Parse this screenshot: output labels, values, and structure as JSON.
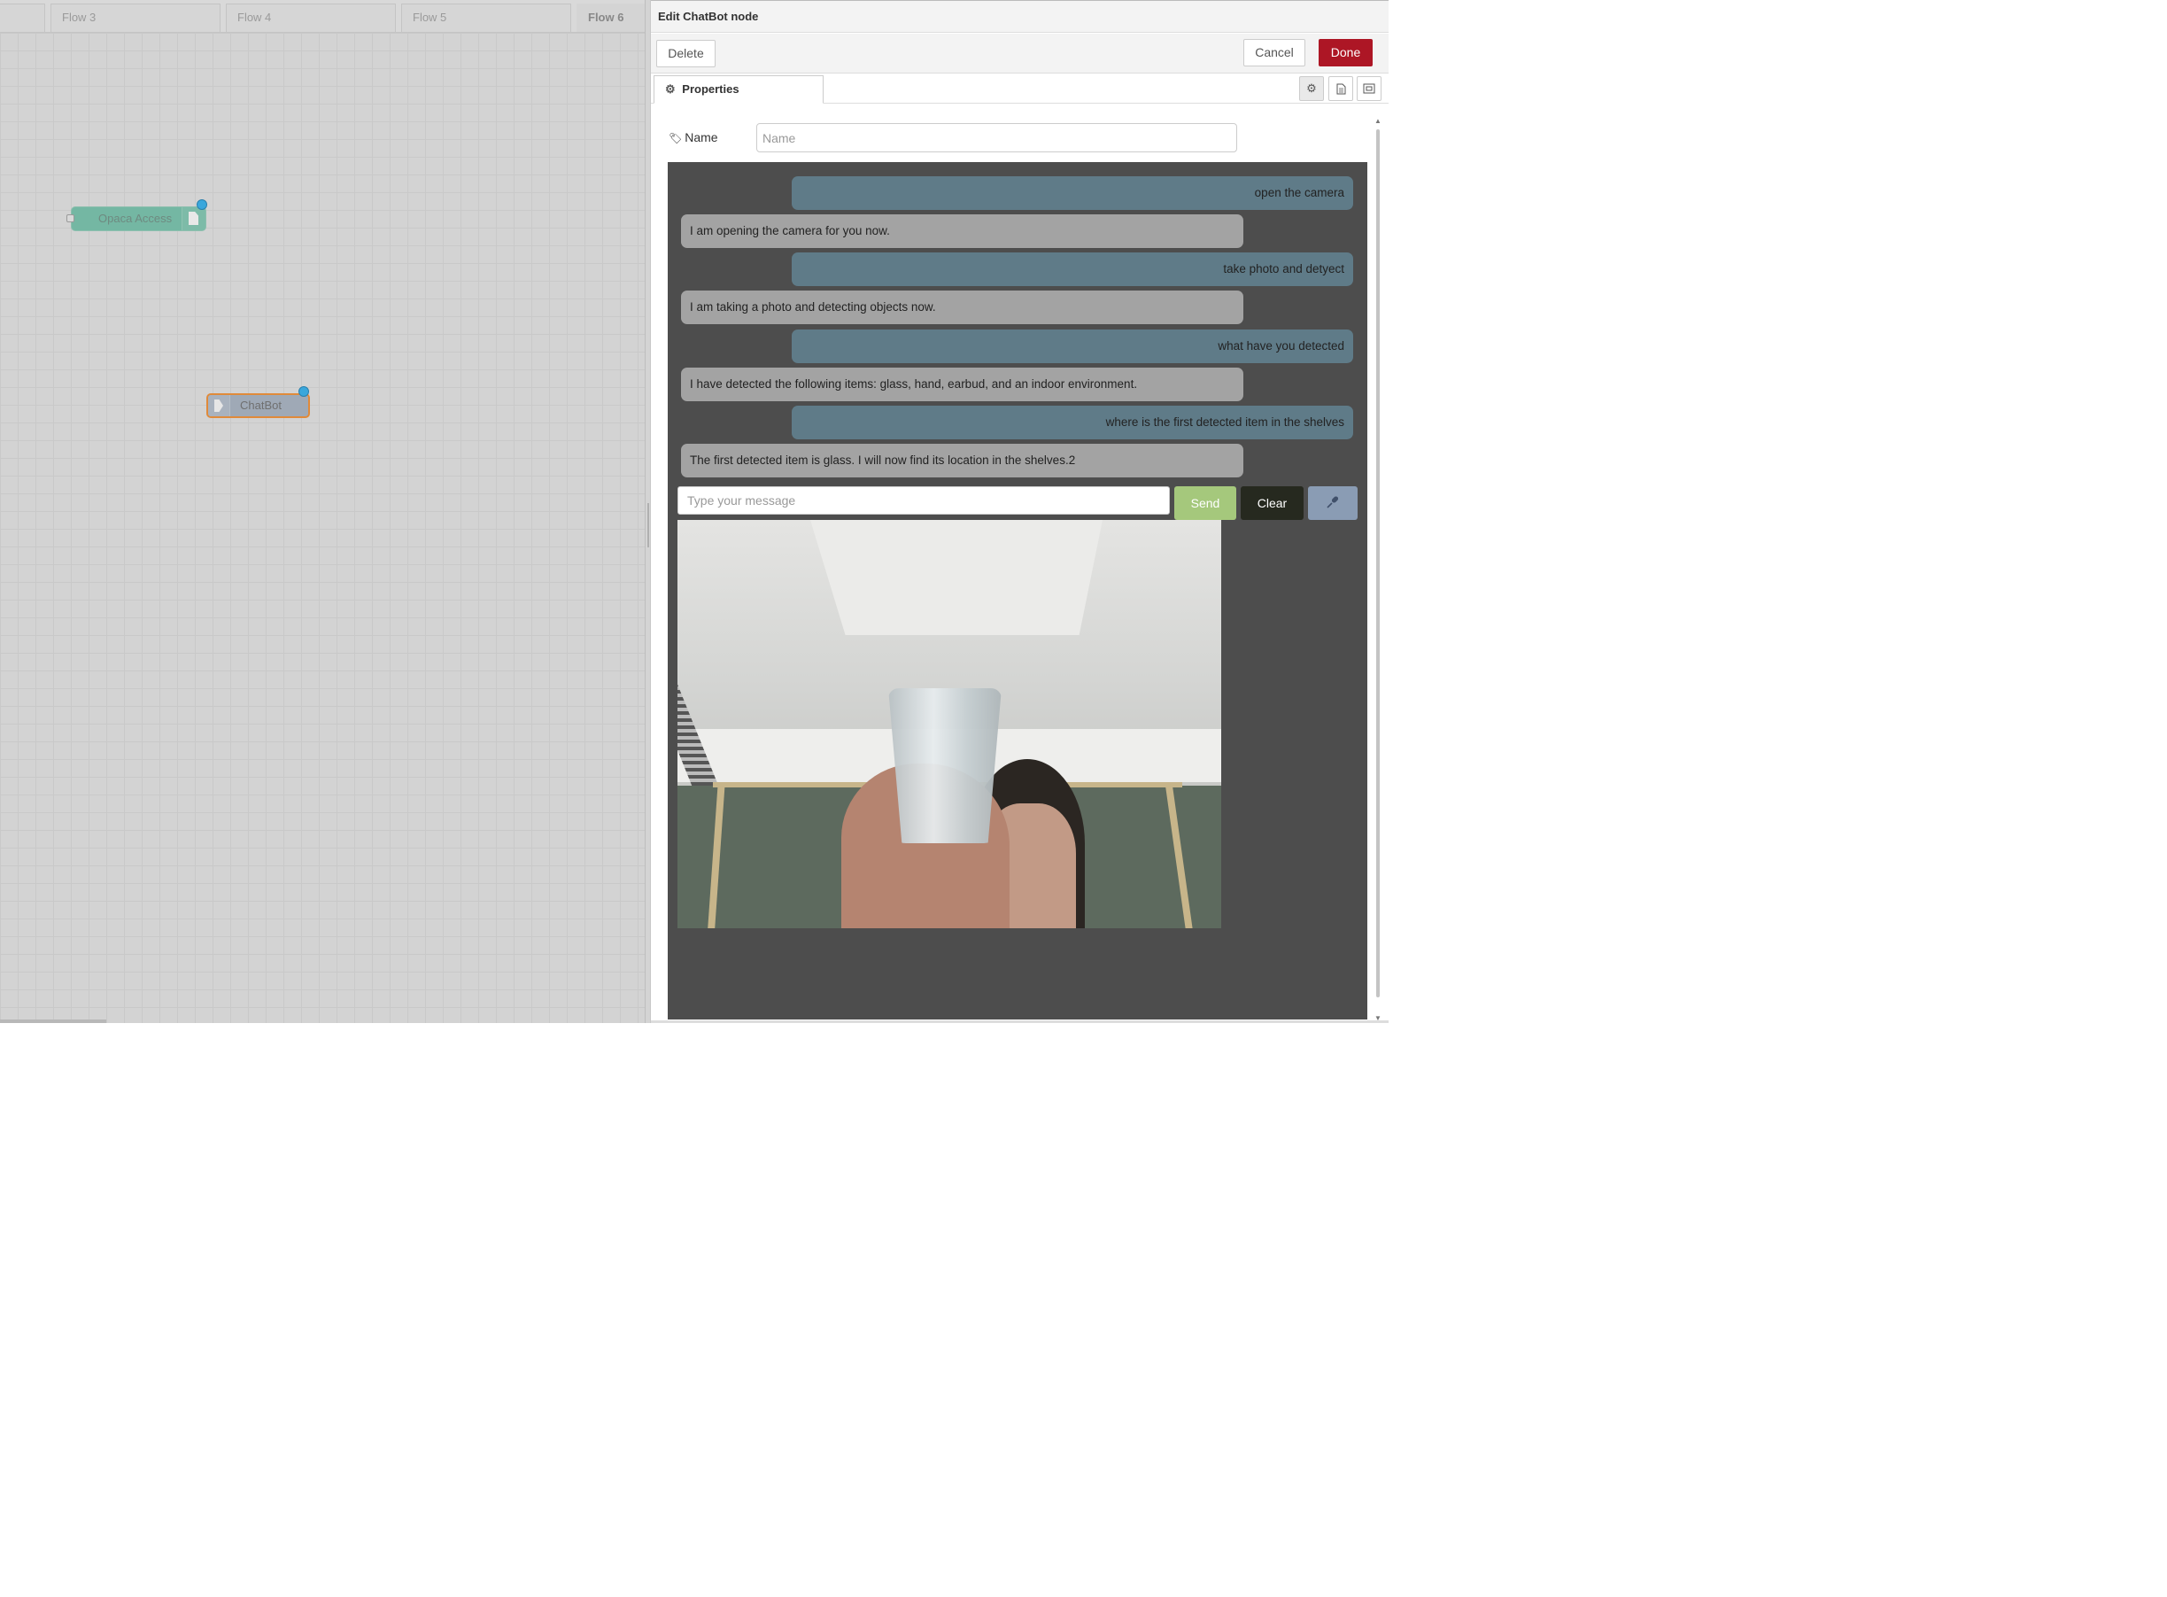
{
  "workspace": {
    "tabs": [
      {
        "label": ""
      },
      {
        "label": "Flow 3"
      },
      {
        "label": "Flow 4"
      },
      {
        "label": "Flow 5"
      },
      {
        "label": "Flow 6"
      }
    ],
    "nodes": {
      "opaca": {
        "label": "Opaca Access",
        "color": "#74b7a3"
      },
      "chatbot": {
        "label": "ChatBot",
        "color": "#9fa9b6"
      }
    }
  },
  "tray": {
    "title": "Edit ChatBot node",
    "toolbar": {
      "delete_label": "Delete",
      "cancel_label": "Cancel",
      "done_label": "Done"
    },
    "tabs": {
      "properties_label": "Properties",
      "icons": [
        "gear-icon",
        "document-icon",
        "appearance-icon"
      ]
    },
    "name_field": {
      "label": "Name",
      "placeholder": "Name",
      "value": ""
    },
    "chat": {
      "messages": [
        {
          "role": "user",
          "text": "open the camera"
        },
        {
          "role": "bot",
          "text": "I am opening the camera for you now."
        },
        {
          "role": "user",
          "text": "take photo and detyect"
        },
        {
          "role": "bot",
          "text": "I am taking a photo and detecting objects now."
        },
        {
          "role": "user",
          "text": "what have you detected"
        },
        {
          "role": "bot",
          "text": "I have detected the following items: glass, hand, earbud, and an indoor environment."
        },
        {
          "role": "user",
          "text": "where is the first detected item in the shelves"
        },
        {
          "role": "bot",
          "text": "The first detected item is glass. I will now find its location in the shelves.2"
        }
      ],
      "input_placeholder": "Type your message",
      "send_label": "Send",
      "clear_label": "Clear",
      "mic_icon": "microphone-icon"
    }
  },
  "colors": {
    "done": "#ad1625",
    "user_bubble": "#5f7b88",
    "bot_bubble": "#a3a3a3",
    "chat_bg": "#4d4d4d",
    "send": "#a5c87c",
    "clear": "#26291f",
    "mic": "#8a9cb4",
    "selected_node_border": "#e08a3a",
    "status_dot": "#3aa7dc"
  }
}
